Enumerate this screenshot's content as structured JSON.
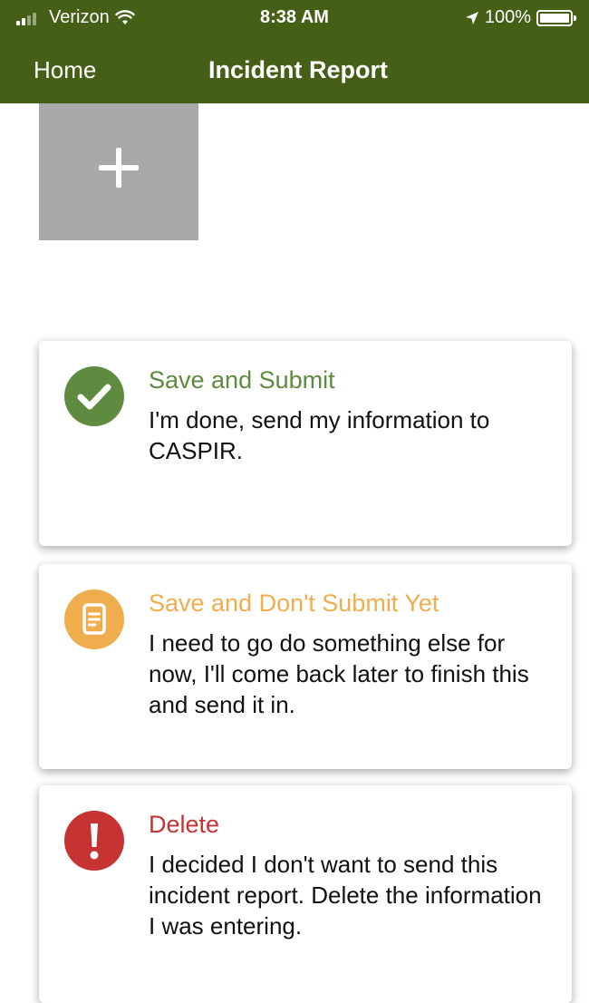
{
  "status_bar": {
    "carrier": "Verizon",
    "time": "8:38 AM",
    "battery": "100%",
    "battery_level": 1.0,
    "icons": [
      "signal-icon",
      "wifi-icon",
      "location-arrow-icon",
      "battery-icon"
    ]
  },
  "nav": {
    "back_label": "Home",
    "title": "Incident Report"
  },
  "add_photo": {
    "icon": "plus-icon"
  },
  "options": [
    {
      "title": "Save and Submit",
      "description": "I'm done, send my information to CASPIR.",
      "icon": "checkmark-icon",
      "color": "#5e8b3f"
    },
    {
      "title": "Save and Don't Submit Yet",
      "description": "I need to go do something else for now, I'll come back later to finish this and send it in.",
      "icon": "document-icon",
      "color": "#f0ad4e"
    },
    {
      "title": "Delete",
      "description": "I decided I don't want to send this incident report. Delete the information I was entering.",
      "icon": "exclamation-icon",
      "color": "#c73232"
    }
  ],
  "colors": {
    "header": "#465f16",
    "add_photo_bg": "#a9a9a9"
  }
}
